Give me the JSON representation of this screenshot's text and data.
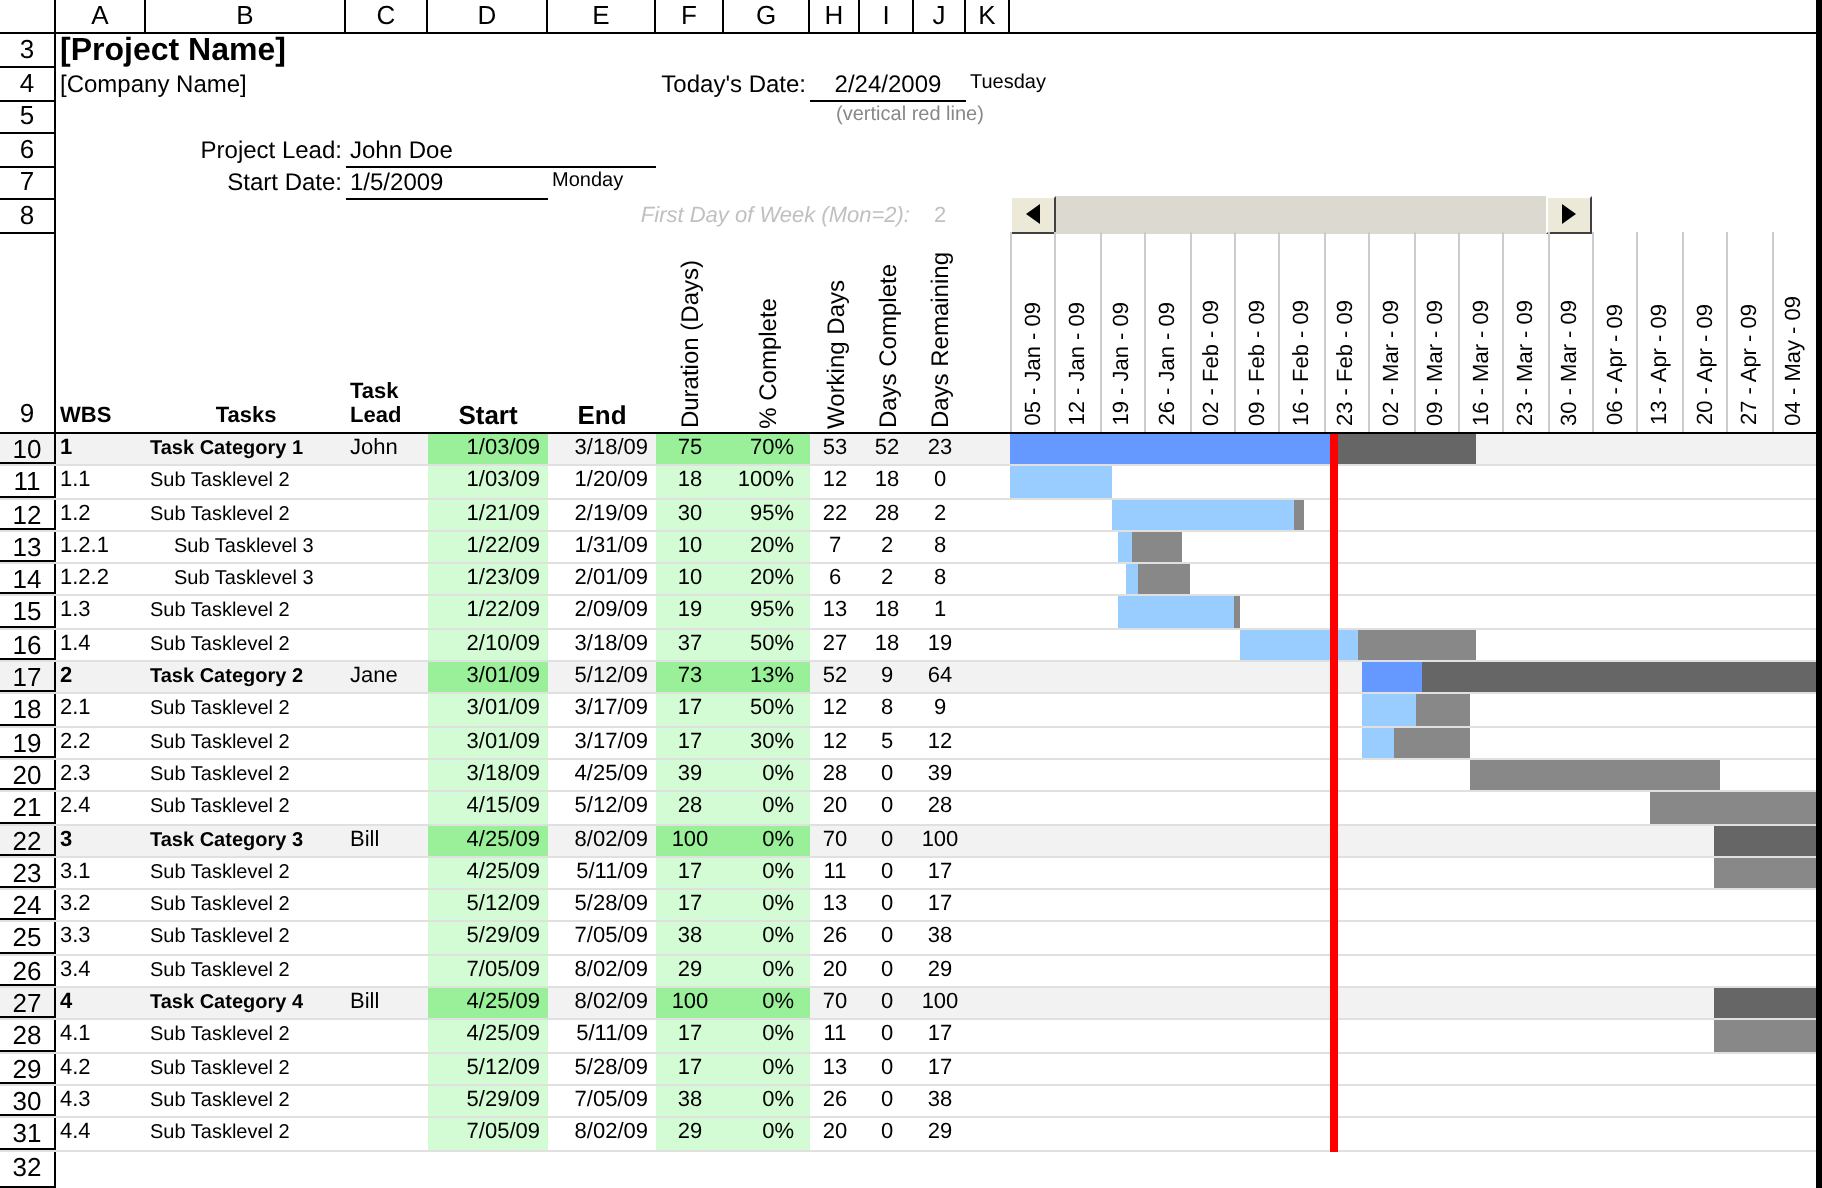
{
  "column_letters": [
    "A",
    "B",
    "C",
    "D",
    "E",
    "F",
    "G",
    "H",
    "I",
    "J",
    "K"
  ],
  "row_numbers": [
    "3",
    "4",
    "5",
    "6",
    "7",
    "8",
    "9",
    "10",
    "11",
    "12",
    "13",
    "14",
    "15",
    "16",
    "17",
    "18",
    "19",
    "20",
    "21",
    "22",
    "23",
    "24",
    "25",
    "26",
    "27",
    "28",
    "29",
    "30",
    "31",
    "32"
  ],
  "title": "[Project Name]",
  "company": "[Company Name]",
  "today": {
    "label": "Today's Date:",
    "date": "2/24/2009",
    "weekday": "Tuesday",
    "note": "(vertical red line)"
  },
  "project_lead": {
    "label": "Project Lead:",
    "value": "John Doe"
  },
  "start_date": {
    "label": "Start Date:",
    "value": "1/5/2009",
    "weekday": "Monday"
  },
  "first_day_of_week": {
    "label": "First Day of Week (Mon=2):",
    "value": "2"
  },
  "table": {
    "columns": [
      "WBS",
      "Tasks",
      "Task Lead",
      "Start",
      "End",
      "Duration (Days)",
      "% Complete",
      "Working Days",
      "Days Complete",
      "Days Remaining"
    ],
    "rows": [
      {
        "kind": "category",
        "wbs": "1",
        "task": "Task Category 1",
        "lead": "John",
        "start": "1/03/09",
        "end": "3/18/09",
        "duration": "75",
        "pct": "70%",
        "working": "53",
        "done": "52",
        "remaining": "23",
        "level": 0.7
      },
      {
        "kind": "level2",
        "wbs": "1.1",
        "task": "Sub Tasklevel 2",
        "start": "1/03/09",
        "end": "1/20/09",
        "duration": "18",
        "pct": "100%",
        "working": "12",
        "done": "18",
        "remaining": "0",
        "level": 1
      },
      {
        "kind": "level2",
        "wbs": "1.2",
        "task": "Sub Tasklevel 2",
        "start": "1/21/09",
        "end": "2/19/09",
        "duration": "30",
        "pct": "95%",
        "working": "22",
        "done": "28",
        "remaining": "2",
        "level": 0.95
      },
      {
        "kind": "level3",
        "wbs": "1.2.1",
        "task": "Sub Tasklevel 3",
        "start": "1/22/09",
        "end": "1/31/09",
        "duration": "10",
        "pct": "20%",
        "working": "7",
        "done": "2",
        "remaining": "8",
        "level": 0.2
      },
      {
        "kind": "level3",
        "wbs": "1.2.2",
        "task": "Sub Tasklevel 3",
        "start": "1/23/09",
        "end": "2/01/09",
        "duration": "10",
        "pct": "20%",
        "working": "6",
        "done": "2",
        "remaining": "8",
        "level": 0.2
      },
      {
        "kind": "level2",
        "wbs": "1.3",
        "task": "Sub Tasklevel 2",
        "start": "1/22/09",
        "end": "2/09/09",
        "duration": "19",
        "pct": "95%",
        "working": "13",
        "done": "18",
        "remaining": "1",
        "level": 0.95
      },
      {
        "kind": "level2",
        "wbs": "1.4",
        "task": "Sub Tasklevel 2",
        "start": "2/10/09",
        "end": "3/18/09",
        "duration": "37",
        "pct": "50%",
        "working": "27",
        "done": "18",
        "remaining": "19",
        "level": 0.5
      },
      {
        "kind": "category",
        "wbs": "2",
        "task": "Task Category 2",
        "lead": "Jane",
        "start": "3/01/09",
        "end": "5/12/09",
        "duration": "73",
        "pct": "13%",
        "working": "52",
        "done": "9",
        "remaining": "64",
        "level": 0.13
      },
      {
        "kind": "level2",
        "wbs": "2.1",
        "task": "Sub Tasklevel 2",
        "start": "3/01/09",
        "end": "3/17/09",
        "duration": "17",
        "pct": "50%",
        "working": "12",
        "done": "8",
        "remaining": "9",
        "level": 0.5
      },
      {
        "kind": "level2",
        "wbs": "2.2",
        "task": "Sub Tasklevel 2",
        "start": "3/01/09",
        "end": "3/17/09",
        "duration": "17",
        "pct": "30%",
        "working": "12",
        "done": "5",
        "remaining": "12",
        "level": 0.3
      },
      {
        "kind": "level2",
        "wbs": "2.3",
        "task": "Sub Tasklevel 2",
        "start": "3/18/09",
        "end": "4/25/09",
        "duration": "39",
        "pct": "0%",
        "working": "28",
        "done": "0",
        "remaining": "39"
      },
      {
        "kind": "level2",
        "wbs": "2.4",
        "task": "Sub Tasklevel 2",
        "start": "4/15/09",
        "end": "5/12/09",
        "duration": "28",
        "pct": "0%",
        "working": "20",
        "done": "0",
        "remaining": "28"
      },
      {
        "kind": "category",
        "wbs": "3",
        "task": "Task Category 3",
        "lead": "Bill",
        "start": "4/25/09",
        "end": "8/02/09",
        "duration": "100",
        "pct": "0%",
        "working": "70",
        "done": "0",
        "remaining": "100"
      },
      {
        "kind": "level2",
        "wbs": "3.1",
        "task": "Sub Tasklevel 2",
        "start": "4/25/09",
        "end": "5/11/09",
        "duration": "17",
        "pct": "0%",
        "working": "11",
        "done": "0",
        "remaining": "17"
      },
      {
        "kind": "level2",
        "wbs": "3.2",
        "task": "Sub Tasklevel 2",
        "start": "5/12/09",
        "end": "5/28/09",
        "duration": "17",
        "pct": "0%",
        "working": "13",
        "done": "0",
        "remaining": "17"
      },
      {
        "kind": "level2",
        "wbs": "3.3",
        "task": "Sub Tasklevel 2",
        "start": "5/29/09",
        "end": "7/05/09",
        "duration": "38",
        "pct": "0%",
        "working": "26",
        "done": "0",
        "remaining": "38"
      },
      {
        "kind": "level2",
        "wbs": "3.4",
        "task": "Sub Tasklevel 2",
        "start": "7/05/09",
        "end": "8/02/09",
        "duration": "29",
        "pct": "0%",
        "working": "20",
        "done": "0",
        "remaining": "29"
      },
      {
        "kind": "category",
        "wbs": "4",
        "task": "Task Category 4",
        "lead": "Bill",
        "start": "4/25/09",
        "end": "8/02/09",
        "duration": "100",
        "pct": "0%",
        "working": "70",
        "done": "0",
        "remaining": "100"
      },
      {
        "kind": "level2",
        "wbs": "4.1",
        "task": "Sub Tasklevel 2",
        "start": "4/25/09",
        "end": "5/11/09",
        "duration": "17",
        "pct": "0%",
        "working": "11",
        "done": "0",
        "remaining": "17"
      },
      {
        "kind": "level2",
        "wbs": "4.2",
        "task": "Sub Tasklevel 2",
        "start": "5/12/09",
        "end": "5/28/09",
        "duration": "17",
        "pct": "0%",
        "working": "13",
        "done": "0",
        "remaining": "17"
      },
      {
        "kind": "level2",
        "wbs": "4.3",
        "task": "Sub Tasklevel 2",
        "start": "5/29/09",
        "end": "7/05/09",
        "duration": "38",
        "pct": "0%",
        "working": "26",
        "done": "0",
        "remaining": "38"
      },
      {
        "kind": "level2",
        "wbs": "4.4",
        "task": "Sub Tasklevel 2",
        "start": "7/05/09",
        "end": "8/02/09",
        "duration": "29",
        "pct": "0%",
        "working": "20",
        "done": "0",
        "remaining": "29"
      }
    ]
  },
  "gantt": {
    "weeks": [
      "05 - Jan - 09",
      "12 - Jan - 09",
      "19 - Jan - 09",
      "26 - Jan - 09",
      "02 - Feb - 09",
      "09 - Feb - 09",
      "16 - Feb - 09",
      "23 - Feb - 09",
      "02 - Mar - 09",
      "09 - Mar - 09",
      "16 - Mar - 09",
      "23 - Mar - 09",
      "30 - Mar - 09",
      "06 - Apr - 09",
      "13 - Apr - 09",
      "20 - Apr - 09",
      "27 - Apr - 09",
      "04 - May - 09"
    ]
  }
}
